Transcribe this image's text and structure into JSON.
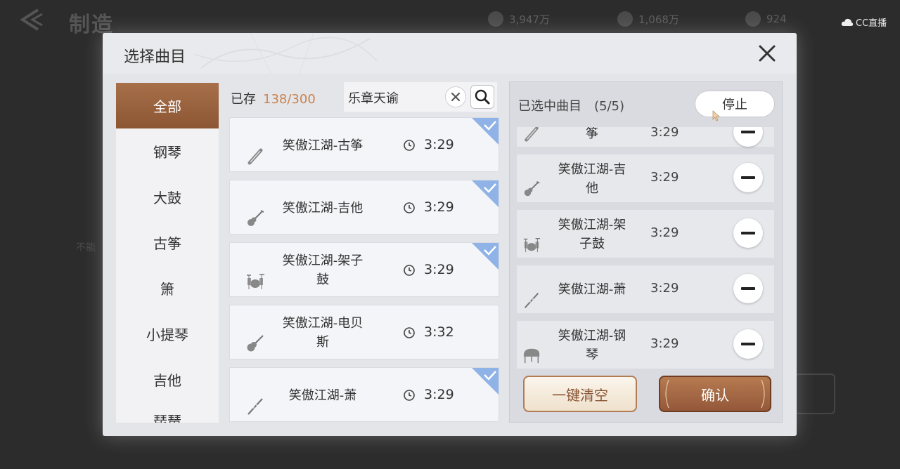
{
  "background": {
    "title": "制造",
    "resources": [
      {
        "value": "3,947万",
        "icon": "crystal-icon"
      },
      {
        "value": "1,068万",
        "icon": "coin-icon"
      },
      {
        "value": "924",
        "icon": "badge-icon"
      }
    ],
    "cc_logo": "CC直播",
    "side_text": "不能"
  },
  "modal": {
    "title": "选择曲目",
    "stored_label": "已存",
    "stored_count": "138/300",
    "search_value": "乐章天谕",
    "categories": [
      {
        "label": "全部",
        "active": true
      },
      {
        "label": "钢琴",
        "active": false
      },
      {
        "label": "大鼓",
        "active": false
      },
      {
        "label": "古筝",
        "active": false
      },
      {
        "label": "箫",
        "active": false
      },
      {
        "label": "小提琴",
        "active": false
      },
      {
        "label": "吉他",
        "active": false
      },
      {
        "label": "琵琶",
        "active": false
      }
    ],
    "songs": [
      {
        "name_line1": "笑傲江湖-古筝",
        "name_line2": "",
        "duration": "3:29",
        "instrument": "guzheng-icon",
        "checked": true
      },
      {
        "name_line1": "笑傲江湖-吉他",
        "name_line2": "",
        "duration": "3:29",
        "instrument": "guitar-icon",
        "checked": true
      },
      {
        "name_line1": "笑傲江湖-架子",
        "name_line2": "鼓",
        "duration": "3:29",
        "instrument": "drum-kit-icon",
        "checked": true
      },
      {
        "name_line1": "笑傲江湖-电贝",
        "name_line2": "斯",
        "duration": "3:32",
        "instrument": "bass-icon",
        "checked": false
      },
      {
        "name_line1": "笑傲江湖-萧",
        "name_line2": "",
        "duration": "3:29",
        "instrument": "flute-icon",
        "checked": true
      }
    ],
    "selected_title": "已选中曲目",
    "selected_count": "(5/5)",
    "stop_label": "停止",
    "selected": [
      {
        "name_line1": "筝",
        "name_line2": "",
        "duration": "3:29",
        "instrument": "guzheng-icon"
      },
      {
        "name_line1": "笑傲江湖-吉",
        "name_line2": "他",
        "duration": "3:29",
        "instrument": "guitar-icon"
      },
      {
        "name_line1": "笑傲江湖-架",
        "name_line2": "子鼓",
        "duration": "3:29",
        "instrument": "drum-kit-icon"
      },
      {
        "name_line1": "笑傲江湖-萧",
        "name_line2": "",
        "duration": "3:29",
        "instrument": "flute-icon"
      },
      {
        "name_line1": "笑傲江湖-钢",
        "name_line2": "琴",
        "duration": "3:29",
        "instrument": "piano-icon"
      }
    ],
    "clear_all_label": "一键清空",
    "confirm_label": "确认"
  }
}
